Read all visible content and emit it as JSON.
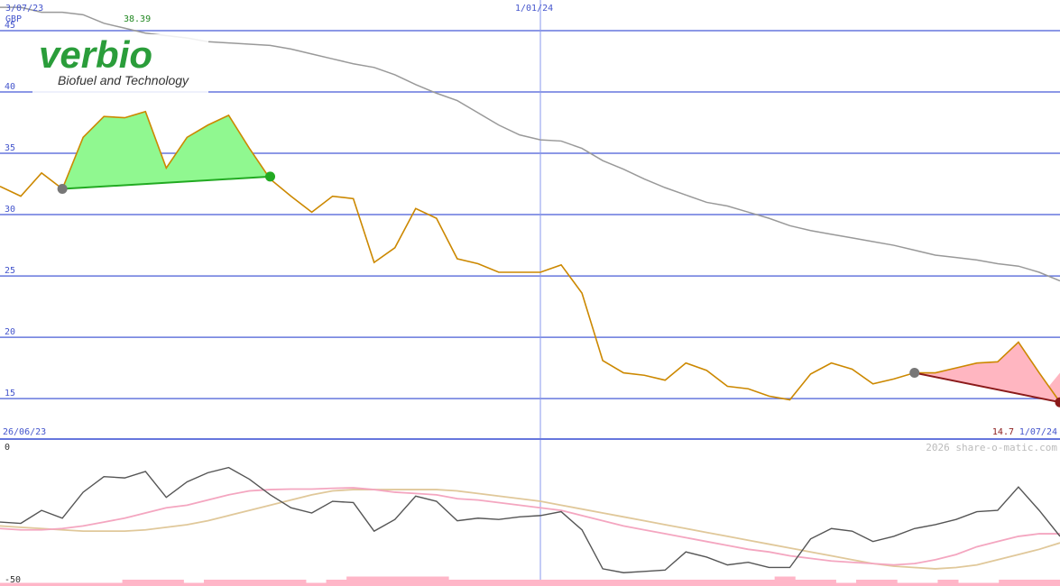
{
  "header": {
    "start_date": "3/07/23",
    "mid_date": "1/01/24",
    "currency": "GBP",
    "peak_value": "38.39"
  },
  "footer": {
    "oscillator_start_date": "26/06/23",
    "last_value": "14.7",
    "end_date": "1/07/24",
    "credit": "2026 share-o-matic.com",
    "osc_top_label": "0",
    "osc_bottom_label": "-50"
  },
  "logo": {
    "name": "verbio",
    "tagline": "Biofuel and Technology"
  },
  "colors": {
    "price": "#cc8800",
    "long_ma": "#999999",
    "grid": "#6677dd",
    "up_fill": "#90f890",
    "down_fill": "#ffb6c1",
    "up_trend": "#22aa22",
    "down_trend": "#8b1a1a",
    "osc_main": "#555555",
    "osc_pink": "#f4a6c0",
    "osc_tan": "#e0c89a",
    "volume": "#ffb6c8"
  },
  "chart_data": {
    "type": "line",
    "ylim": [
      11.7,
      47.5
    ],
    "y_ticks": [
      15,
      20,
      25,
      30,
      35,
      40,
      45
    ],
    "x_range": [
      0,
      51
    ],
    "x_ticks": [
      {
        "x": 26,
        "label": "1/01/24"
      }
    ],
    "series": [
      {
        "values": [
          32.3,
          31.5,
          33.4,
          32.1,
          36.3,
          38,
          37.9,
          38.4,
          33.8,
          36.3,
          37.3,
          38.1,
          35.4,
          32.9,
          31.5,
          30.2,
          31.5,
          31.3,
          26.1,
          27.3,
          30.5,
          29.7,
          26.4,
          26,
          25.3,
          25.3,
          25.3,
          25.9,
          23.6,
          18.1,
          17.1,
          16.9,
          16.5,
          17.9,
          17.3,
          16,
          15.8,
          15.2,
          14.9,
          17,
          17.9,
          17.4,
          16.2,
          16.6,
          17.1,
          17.1,
          17.5,
          17.9,
          18,
          19.6,
          17.1,
          14.7
        ]
      },
      {
        "values": [
          46.9,
          46.9,
          46.5,
          46.5,
          46.3,
          45.6,
          45.2,
          44.8,
          44.6,
          44.4,
          44.1,
          44,
          43.9,
          43.8,
          43.5,
          43.1,
          42.7,
          42.3,
          42,
          41.4,
          40.6,
          39.9,
          39.3,
          38.3,
          37.3,
          36.5,
          36.1,
          36,
          35.4,
          34.4,
          33.7,
          32.9,
          32.2,
          31.6,
          31,
          30.7,
          30.2,
          29.7,
          29.1,
          28.7,
          28.4,
          28.1,
          27.8,
          27.5,
          27.1,
          26.7,
          26.5,
          26.3,
          26,
          25.8,
          25.3,
          24.6
        ]
      }
    ],
    "trend_lines": [
      {
        "direction": "up",
        "from": {
          "x": 3,
          "y": 32.1
        },
        "to": {
          "x": 13,
          "y": 33.1
        }
      },
      {
        "direction": "down",
        "from": {
          "x": 44,
          "y": 17.1
        },
        "to": {
          "x": 51,
          "y": 14.7
        }
      }
    ],
    "oscillator": {
      "ylim": [
        -50,
        0
      ],
      "main": [
        -28.5,
        -29,
        -24,
        -27,
        -17,
        -11,
        -11.5,
        -9,
        -19,
        -13,
        -9.5,
        -7.5,
        -12,
        -18,
        -23,
        -25,
        -20.5,
        -21,
        -32,
        -27.5,
        -18.5,
        -20.5,
        -28,
        -27,
        -27.5,
        -26.5,
        -26,
        -24.5,
        -31.5,
        -46.5,
        -48,
        -47.5,
        -47,
        -40,
        -42,
        -45,
        -44,
        -46,
        -46,
        -35,
        -31,
        -32,
        -36,
        -34,
        -31,
        -29.5,
        -27.5,
        -24.5,
        -24,
        -15,
        -24,
        -34
      ],
      "pink": [
        -31,
        -31.5,
        -31.5,
        -31,
        -30,
        -28.5,
        -27,
        -25,
        -23,
        -22,
        -20,
        -18,
        -16.5,
        -16,
        -15.8,
        -15.8,
        -15.5,
        -15.3,
        -16,
        -17,
        -17.5,
        -18,
        -19.5,
        -20,
        -21,
        -22,
        -23,
        -24,
        -26,
        -28,
        -30,
        -31.5,
        -33,
        -34.5,
        -36,
        -37.5,
        -39,
        -40,
        -41.5,
        -42.5,
        -43.5,
        -44,
        -44.5,
        -45,
        -44.5,
        -43,
        -41,
        -38,
        -36,
        -34,
        -33,
        -33
      ],
      "tan": [
        -30,
        -30.5,
        -31,
        -31.5,
        -32,
        -32,
        -32,
        -31.5,
        -30.5,
        -29.5,
        -28,
        -26,
        -24,
        -22,
        -20,
        -18,
        -16.5,
        -16,
        -16,
        -16,
        -16,
        -16,
        -16.5,
        -17.5,
        -18.5,
        -19.5,
        -20.5,
        -22,
        -23.5,
        -25,
        -26.5,
        -28,
        -29.5,
        -31,
        -32.5,
        -34,
        -35.5,
        -37,
        -38.5,
        -40,
        -41.5,
        -43,
        -44.5,
        -45.5,
        -46,
        -46.5,
        -46,
        -45,
        -43,
        -41,
        -39,
        -36.5
      ],
      "volume": [
        1,
        1,
        1,
        1,
        1,
        1,
        2,
        2,
        2,
        1,
        2,
        2,
        2,
        2,
        2,
        1,
        2,
        3,
        3,
        3,
        3,
        3,
        2,
        2,
        2,
        2,
        2,
        2,
        2,
        2,
        2,
        2,
        2,
        2,
        2,
        2,
        2,
        2,
        3,
        2,
        2,
        1,
        2,
        2,
        1,
        1,
        2,
        1,
        1,
        2,
        2,
        2
      ]
    }
  }
}
